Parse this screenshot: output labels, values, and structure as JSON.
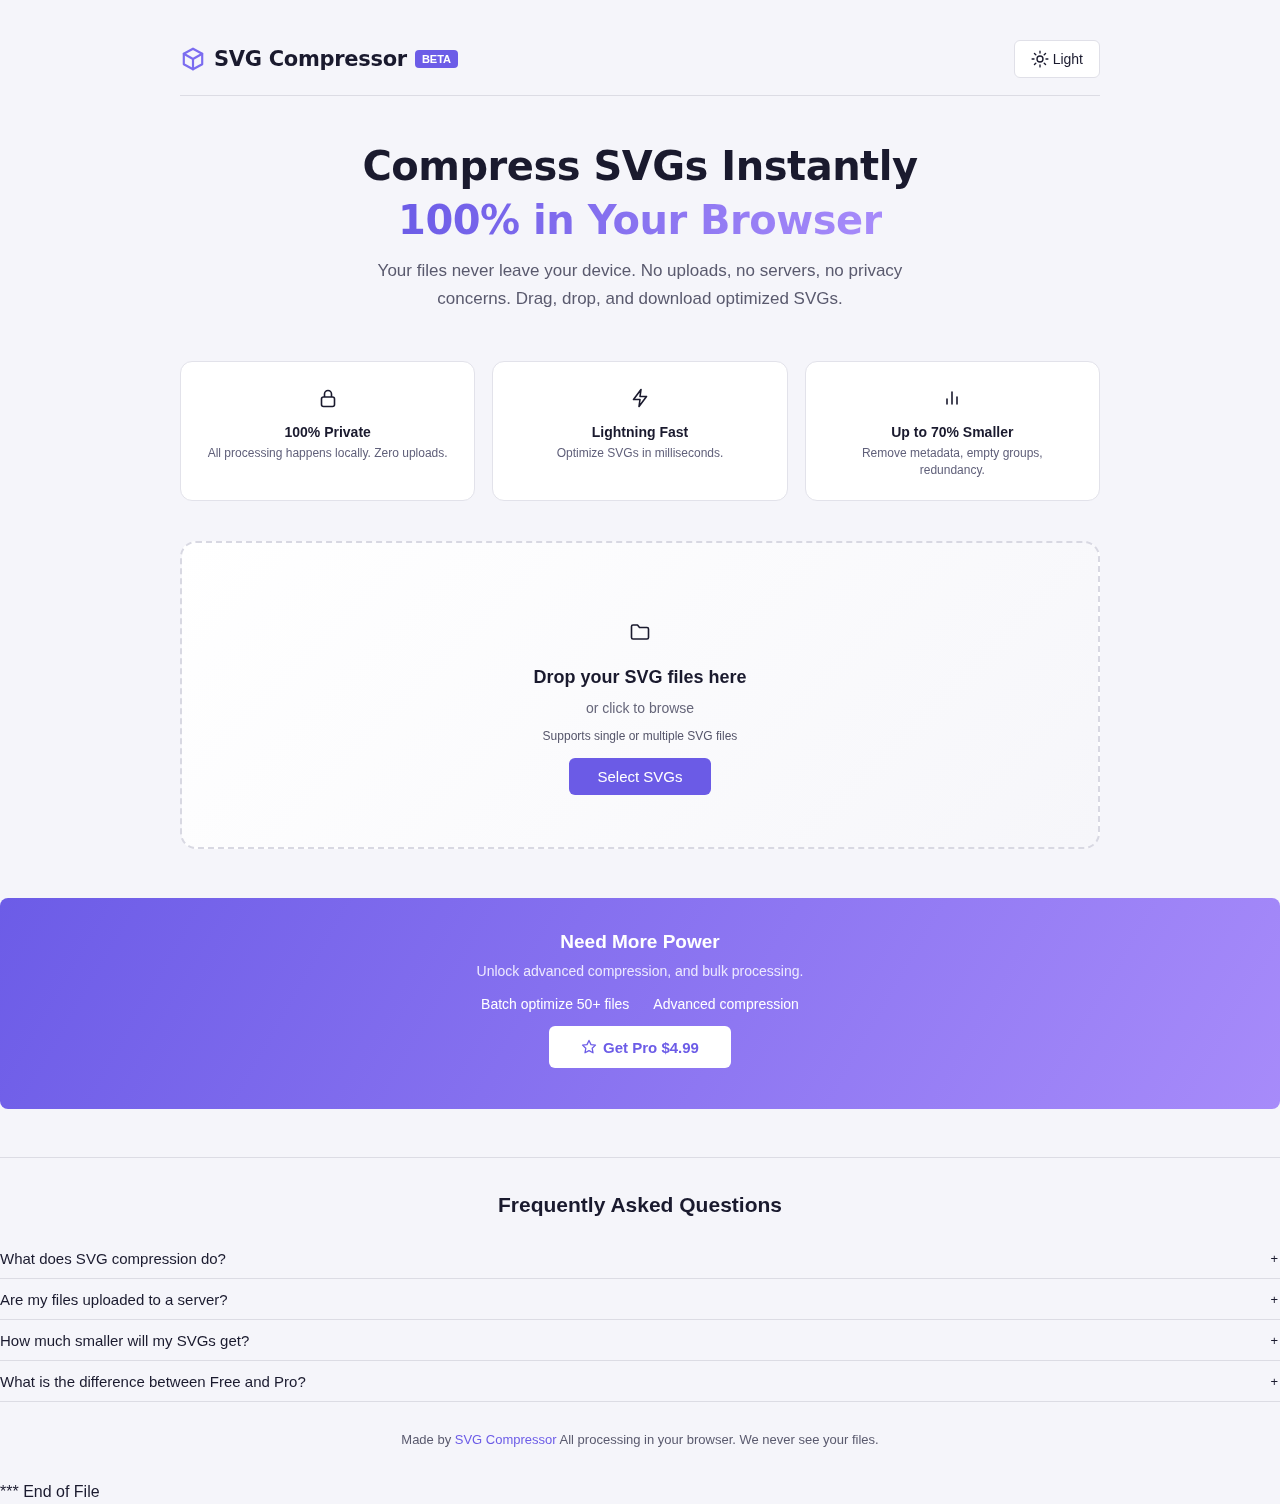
{
  "header": {
    "logo_text": "SVG Compressor",
    "badge": "BETA",
    "theme_button": "Light"
  },
  "hero": {
    "title": "Compress SVGs Instantly",
    "highlight": "100% in Your Browser",
    "subtitle": "Your files never leave your device. No uploads, no servers, no privacy concerns. Drag, drop, and download optimized SVGs."
  },
  "features": [
    {
      "title": "100% Private",
      "description": "All processing happens locally. Zero uploads."
    },
    {
      "title": "Lightning Fast",
      "description": "Optimize SVGs in milliseconds."
    },
    {
      "title": "Up to 70% Smaller",
      "description": "Remove metadata, empty groups, redundancy."
    }
  ],
  "dropzone": {
    "title": "Drop your SVG files here",
    "hint": "or click to browse",
    "note": "Supports single or multiple SVG files",
    "button": "Select SVGs"
  },
  "pro": {
    "title": "Need More Power",
    "subtitle": "Unlock advanced compression, and bulk processing.",
    "features": [
      "Batch optimize 50+ files",
      "Advanced compression"
    ],
    "button": "Get Pro $4.99"
  },
  "faq": {
    "title": "Frequently Asked Questions",
    "items": [
      {
        "question": "What does SVG compression do?",
        "toggle": "+"
      },
      {
        "question": "Are my files uploaded to a server?",
        "toggle": "+"
      },
      {
        "question": "How much smaller will my SVGs get?",
        "toggle": "+"
      },
      {
        "question": "What is the difference between Free and Pro?",
        "toggle": "+"
      }
    ]
  },
  "footer": {
    "prefix": "Made by",
    "link": "SVG Compressor",
    "suffix": "All processing in your browser. We never see your files."
  },
  "end_note": "*** End of File"
}
